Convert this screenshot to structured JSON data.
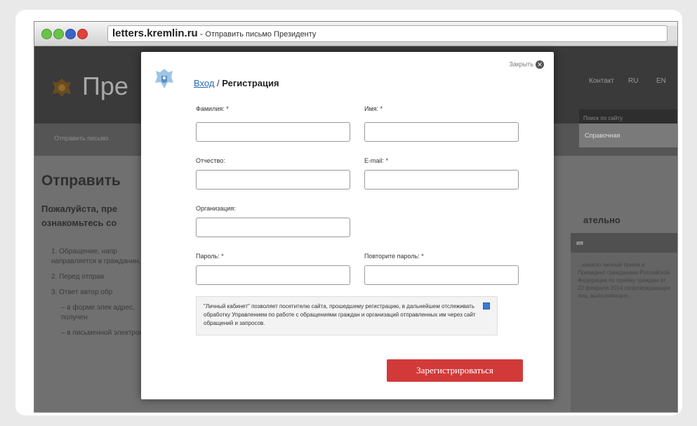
{
  "browser": {
    "url_host": "letters.kremlin.ru",
    "url_separator": " - ",
    "page_title": "Отправить письмо Президенту"
  },
  "background_site": {
    "site_title": "Пре",
    "nav_first_item": "Отправить письмо",
    "header_links": [
      "Контакт",
      "RU",
      "EN"
    ],
    "search_text": "Поиск по сайту",
    "right_tab": "Справочная",
    "page_heading": "Отправить",
    "lead_text": "Пожалуйста, пре ознакомьтесь со",
    "lead_right": "ательно",
    "list_items": [
      "1. Обращение, напр направляется в гражданин.",
      "2. Перед отправ",
      "3. Ответ автор обр",
      "– в форме элек адрес, получен",
      "– в письменной электронный"
    ],
    "side_box_heading": "ия",
    "side_box_text": "...начало личный приём в Президент гражданина Российской Федерации по приёму граждан от 22 февраля 2014 сопровождающих лиц, выполняющих..."
  },
  "modal": {
    "close_label": "Закрыть",
    "tab_login": "Вход",
    "tab_separator": " / ",
    "tab_register": "Регистрация",
    "fields": {
      "last_name_label": "Фамилия: *",
      "first_name_label": "Имя: *",
      "patronymic_label": "Отчество:",
      "email_label": "E-mail: *",
      "organization_label": "Организация:",
      "password_label": "Пароль: *",
      "password_repeat_label": "Повторите пароль: *"
    },
    "note_text": "\"Личный кабинет\" позволяет посетителю сайта, прошедшему регистрацию, в дальнейшем отслеживать обработку Управлением по работе с обращениями граждан и организаций отправленных им через сайт обращений и запросов.",
    "submit_label": "Зарегистрироваться"
  },
  "colors": {
    "accent_red": "#d23a3a",
    "link_blue": "#2a6bb5",
    "checkbox_blue": "#3a7bd5"
  },
  "icons": [
    "close-icon",
    "emblem-icon",
    "traffic-light-icons"
  ]
}
